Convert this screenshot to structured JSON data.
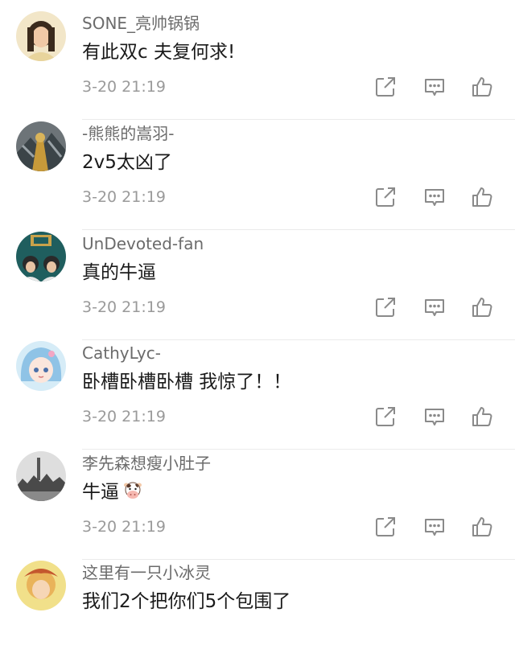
{
  "comments": [
    {
      "username": "SONE_亮帅锅锅",
      "text": "有此双c 夫复何求!",
      "time": "3-20 21:19"
    },
    {
      "username": "-熊熊的嵩羽-",
      "text": "2v5太凶了",
      "time": "3-20 21:19"
    },
    {
      "username": "UnDevoted-fan",
      "text": "真的牛逼",
      "time": "3-20 21:19"
    },
    {
      "username": "CathyLyc-",
      "text": "卧槽卧槽卧槽 我惊了！！",
      "time": "3-20 21:19"
    },
    {
      "username": "李先森想瘦小肚子",
      "text": "牛逼",
      "emoji": "cow-face-emoji",
      "time": "3-20 21:19"
    },
    {
      "username": "这里有一只小冰灵",
      "text": "我们2个把你们5个包围了"
    }
  ],
  "icons": {
    "share": "share-icon",
    "reply": "comment-icon",
    "like": "thumbs-up-icon"
  },
  "colors": {
    "username": "#6b6b6b",
    "text": "#1a1a1a",
    "time": "#9a9a9a",
    "icon": "#8a8a8a",
    "divider": "#ebebeb"
  }
}
